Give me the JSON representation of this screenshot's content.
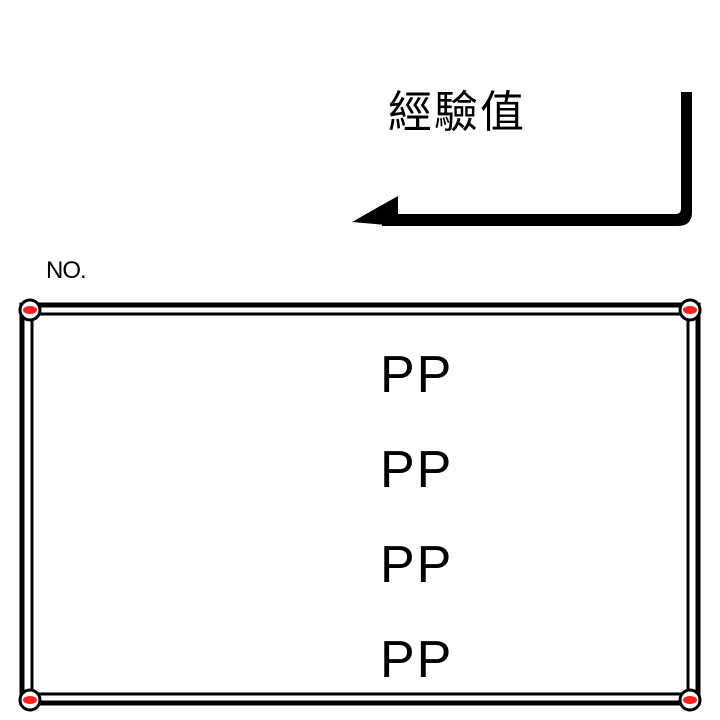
{
  "status": {
    "exp_label": "經驗值",
    "no_label": "NO."
  },
  "pp_panel": {
    "rows": [
      "PP",
      "PP",
      "PP",
      "PP"
    ]
  },
  "colors": {
    "frame": "#000000",
    "corner_fill": "#ff2020",
    "background": "#ffffff"
  }
}
